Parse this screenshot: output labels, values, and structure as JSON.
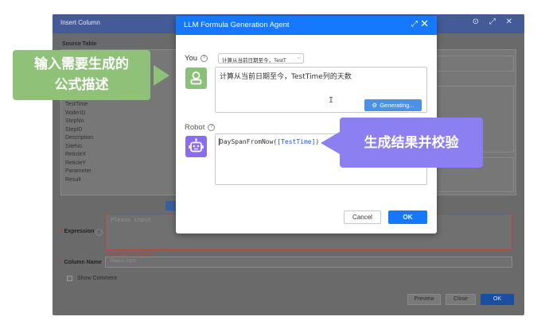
{
  "background_window": {
    "title": "Insert Column",
    "controls": "⊙ ⤢ ✕",
    "source_table_label": "Source Table",
    "fields": [
      "TestTime",
      "WaferID",
      "StepNo",
      "StepID",
      "Description",
      "SiteNo",
      "ReticleX",
      "ReticleY",
      "Parameter",
      "Result"
    ],
    "expression_label": "Expression",
    "expression_placeholder": "Please input",
    "expression_error": "Expression is required",
    "column_name_label": "Column Name",
    "column_name_placeholder": "Please input",
    "show_comment_label": "Show Comment",
    "preview_label": "Preview",
    "close_label": "Close",
    "ok_label": "OK"
  },
  "dialog": {
    "title": "LLM Formula Generation Agent",
    "expand_icon": "expand-icon",
    "close_icon": "close-icon",
    "you_label": "You",
    "you_select_value": "计算从当前日期至今，TestT",
    "input_text": "计算从当前日期至今，TestTime列的天数",
    "generating_label": "Generating...",
    "robot_label": "Robot",
    "output_prefix": "DaySpanFromNow(",
    "output_field": "[TestTime]",
    "output_suffix": ")",
    "cancel_label": "Cancel",
    "ok_label": "OK"
  },
  "callouts": {
    "left_line1": "输入需要生成的",
    "left_line2": "公式描述",
    "right_text": "生成结果并校验"
  },
  "colors": {
    "dialog_header": "#1677ff",
    "you_avatar": "#8ac17a",
    "robot_avatar": "#8a6cf0",
    "callout_left": "#8fc178",
    "callout_right": "#8b7ff2"
  }
}
